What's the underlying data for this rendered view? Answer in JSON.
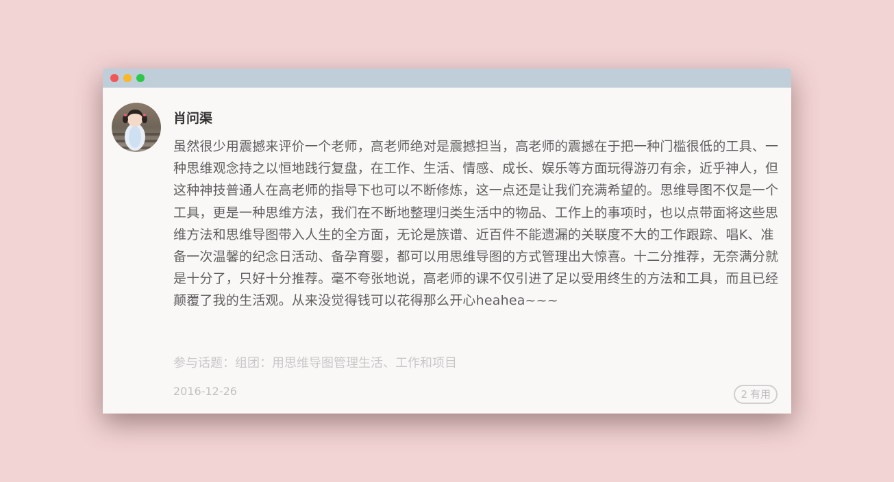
{
  "window": {
    "controls": [
      "close",
      "minimize",
      "maximize"
    ],
    "colors": {
      "titlebar": "#c0ced9",
      "close": "#f25757",
      "minimize": "#f7b928",
      "maximize": "#2dc84a"
    }
  },
  "review": {
    "author": "肖问渠",
    "avatar_icon": "avatar-photo-icon",
    "body": "虽然很少用震撼来评价一个老师，高老师绝对是震撼担当，高老师的震撼在于把一种门槛很低的工具、一种思维观念持之以恒地践行复盘，在工作、生活、情感、成长、娱乐等方面玩得游刃有余，近乎神人，但这种神技普通人在高老师的指导下也可以不断修炼，这一点还是让我们充满希望的。思维导图不仅是一个工具，更是一种思维方法，我们在不断地整理归类生活中的物品、工作上的事项时，也以点带面将这些思维方法和思维导图带入人生的全方面，无论是族谱、近百件不能遗漏的关联度不大的工作跟踪、唱K、准备一次温馨的纪念日活动、备孕育婴，都可以用思维导图的方式管理出大惊喜。十二分推荐，无奈满分就是十分了，只好十分推荐。毫不夸张地说，高老师的课不仅引进了足以受用终生的方法和工具，而且已经颠覆了我的生活观。从来没觉得钱可以花得那么开心heahea~~~",
    "topic_label": "参与话题：",
    "topic_value": "组团：用思维导图管理生活、工作和项目",
    "date": "2016-12-26",
    "useful_count": "2",
    "useful_label": "有用"
  }
}
